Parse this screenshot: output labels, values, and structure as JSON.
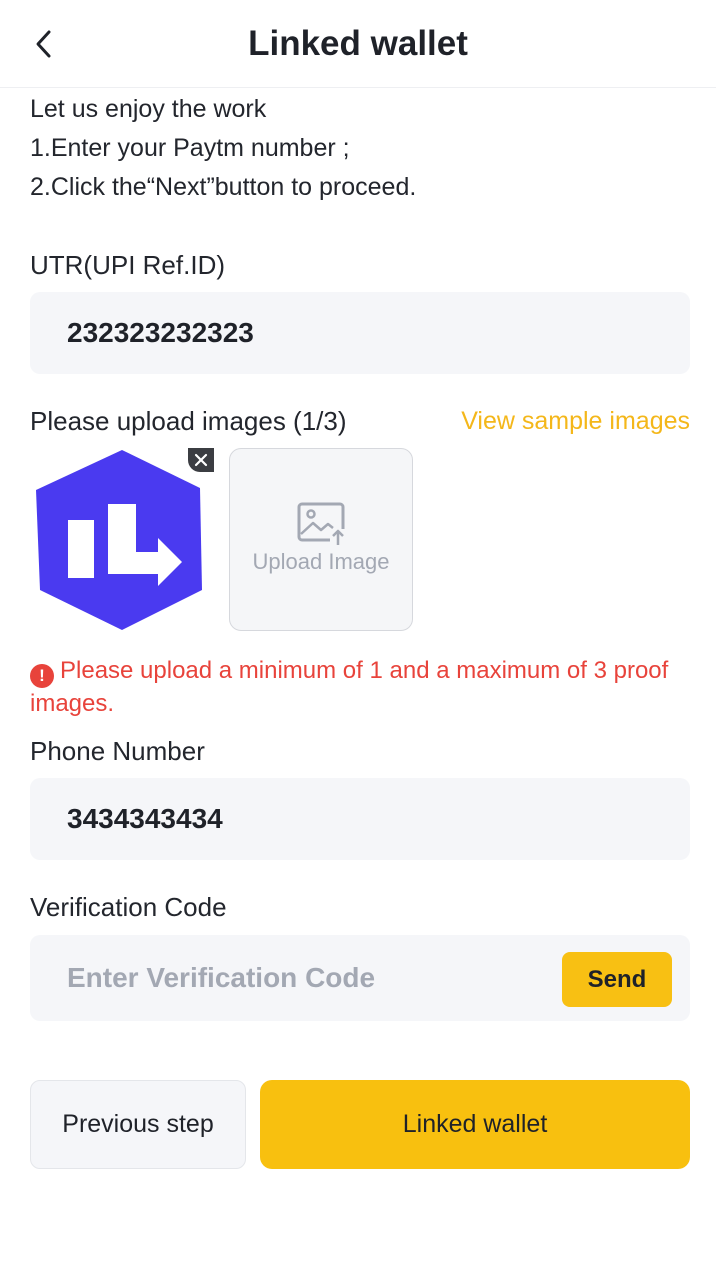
{
  "header": {
    "title": "Linked wallet",
    "back_icon": "chevron-left-icon"
  },
  "intro": {
    "line1": "Let us enjoy the work",
    "line2": "1.Enter your Paytm number ;",
    "line3": "2.Click the“Next”button to proceed."
  },
  "utr": {
    "label": "UTR(UPI Ref.ID)",
    "value": "232323232323"
  },
  "upload": {
    "label": "Please upload images (1/3)",
    "sample_link": "View sample images",
    "upload_text": "Upload Image",
    "thumbnail_icon": "app-logo-icon",
    "remove_icon": "close-icon",
    "upload_icon": "image-upload-icon",
    "error_icon": "alert-icon",
    "error_text": "Please upload a minimum of 1 and a maximum of 3 proof images."
  },
  "phone": {
    "label": "Phone Number",
    "value": "3434343434"
  },
  "verification": {
    "label": "Verification Code",
    "placeholder": "Enter Verification Code",
    "send_label": "Send"
  },
  "footer": {
    "previous_label": "Previous step",
    "primary_label": "Linked wallet"
  },
  "colors": {
    "accent": "#f8c00f",
    "error": "#e8433b",
    "logo": "#4a3af0",
    "field_bg": "#f5f6f9"
  }
}
